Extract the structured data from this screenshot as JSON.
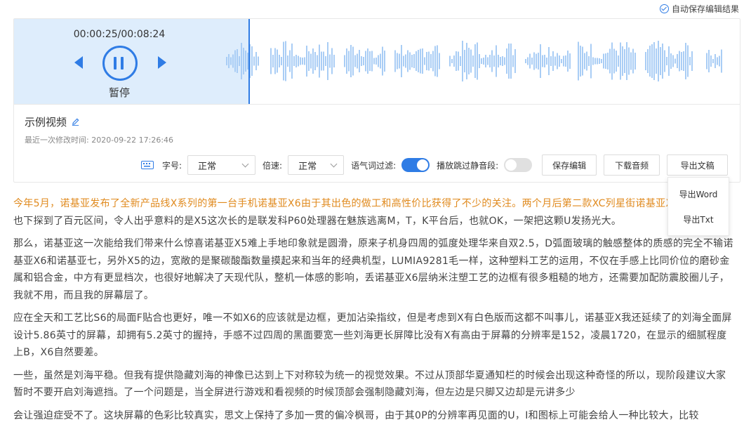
{
  "autosave": {
    "label": "自动保存编辑结果"
  },
  "player": {
    "time": "00:00:25/00:08:24",
    "state_label": "暂停",
    "progress": 0.05,
    "accent": "#2f7ce5",
    "played_bg": "#deedfc"
  },
  "info": {
    "title": "示例视频",
    "modified": "最近一次修改时间: 2020-09-22 17:26:46"
  },
  "toolbar": {
    "font_label": "字号:",
    "font_value": "正常",
    "speed_label": "倍速:",
    "speed_value": "正常",
    "filler_label": "语气词过滤:",
    "filler_on": true,
    "skip_silence_label": "播放跳过静音段:",
    "skip_silence_on": false,
    "save_label": "保存编辑",
    "download_label": "下载音频",
    "export_label": "导出文稿"
  },
  "export_menu": {
    "items": [
      "导出Word",
      "导出Txt"
    ]
  },
  "transcript": {
    "p1_highlight": "今年5月，诺基亚发布了全新产品线X系列的第一台手机诺基亚X6由于其出色的做工和高性价比获得了不少的关注。两个月后第二款XC列星街诺基亚X5发布，价格",
    "p1_rest": "也下探到了百元区间，令人出乎意料的是X5这次长的是联发科P60处理器在魅族逃离M，T，K平台后，也就OK，一架把这颗U发扬光大。",
    "p2": "那么，诺基亚这一次能给我们带来什么惊喜诺基亚X5难上手地印象就是圆滑，原来子机身四周的弧度处理华来自双2.5，D弧面玻璃的触感整体的质感的完全不输诺基亚X6和诺基亚七，另外X5的边，宽敞的是聚碳酸酯数量摸起来和当年的经典机型，LUMIA9281毛一样，这种塑料工艺的运用，不仅在手感上比同价位的磨砂金属和铝合金，中方有更显档次，也很好地解决了天现代队，整机一体感的影响，丢诺基亚X6层纳米注塑工艺的边框有很多粗糙的地方，还需要加配防震胶圈儿子，我就不用，而且我的屏幕层了。",
    "p3": "应在全天和工艺比S6的局面F贴合也更好，唯一不如X6的应该就是边框，更加沾染指纹，但是考虑到X有白色版而这都不叫事儿，诺基亚X我还延续了的刘海全面屏设计5.86英寸的屏幕，却拥有5.2英寸的握持，手感不过四周的黑面要宽一些刘海更长屏障比没有X有高由于屏幕的分辨率是152，凌晨1720，在显示的细腻程度上B，X6自然要差。",
    "p4": "一些，虽然是刘海平稳。但我有提供隐藏刘海的神像已达到上下对称较为统一的视觉效果。不过从顶部华夏通知栏的时候会出现这种奇怪的所以，现阶段建议大家暂时不要开启刘海遮挡。了一个问题是，当全屏进行游戏和看视频的时候顶部会强制隐藏刘海，但左边是只脚又边却是元讲多少",
    "p5": "会让强迫症受不了。这块屏幕的色彩比较真实，思文上保持了多加一贯的偏冷枫哥，由于其0P的分辨率再见面的U，I和图标上可能会给人一种比较大，比较"
  }
}
